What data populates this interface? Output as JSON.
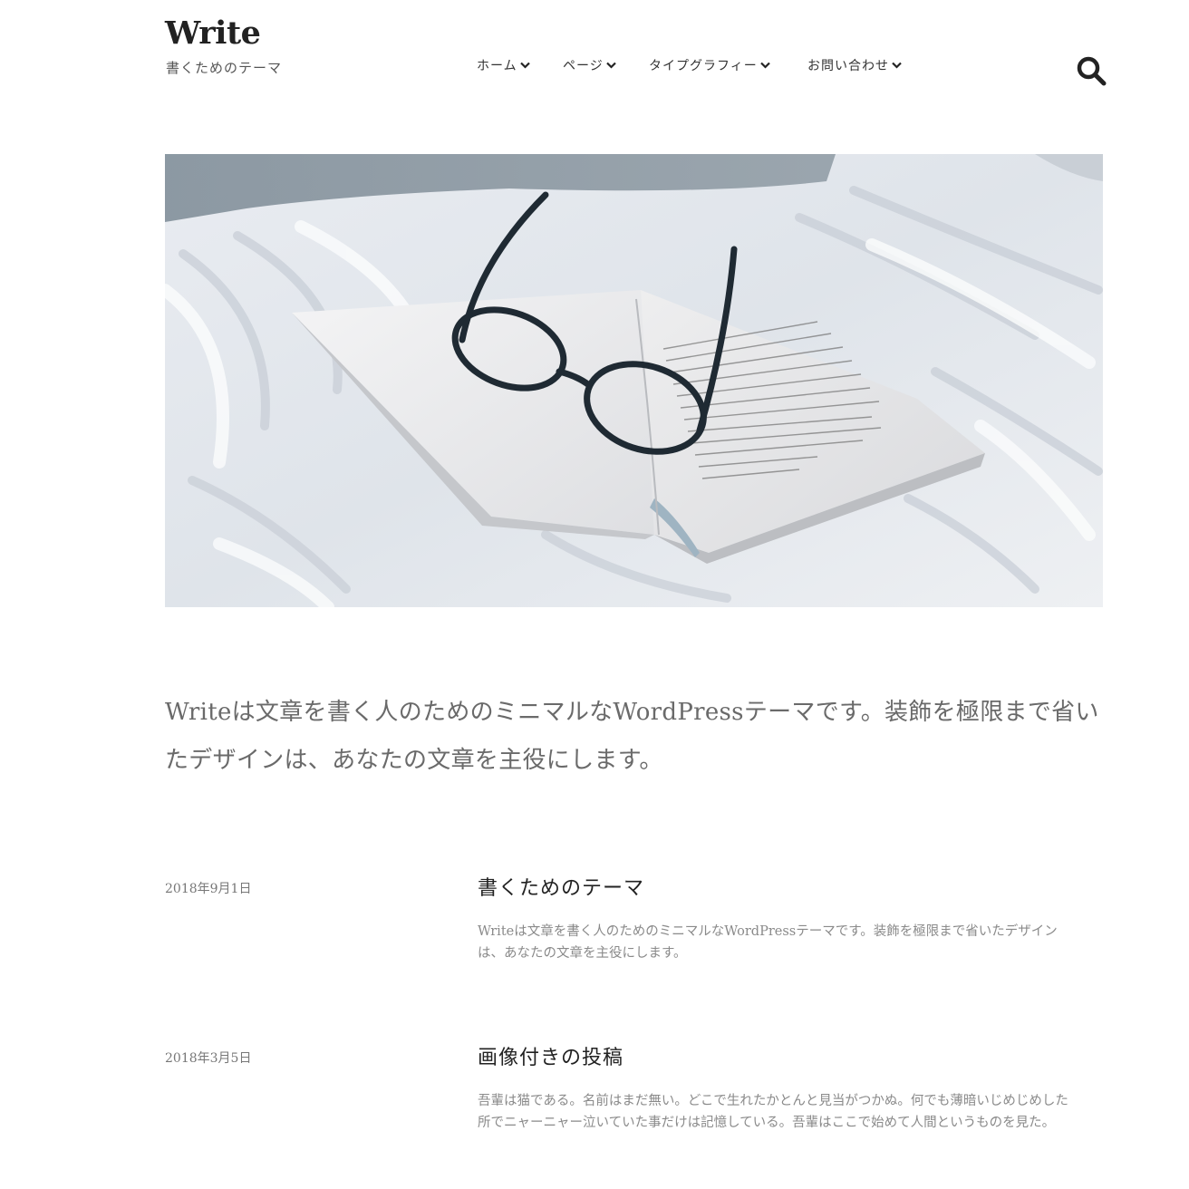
{
  "site": {
    "title": "Write",
    "description": "書くためのテーマ"
  },
  "nav": {
    "items": [
      {
        "label": "ホーム"
      },
      {
        "label": "ページ"
      },
      {
        "label": "タイプグラフィー"
      },
      {
        "label": "お問い合わせ"
      }
    ]
  },
  "hero": {
    "image": "open-book-with-glasses-photo"
  },
  "intro": {
    "text": "Writeは文章を書く人のためのミニマルなWordPressテーマです。装飾を極限まで省いたデザインは、あなたの文章を主役にします。"
  },
  "posts": [
    {
      "date": "2018年9月1日",
      "title": "書くためのテーマ",
      "excerpt": "Writeは文章を書く人のためのミニマルなWordPressテーマです。装飾を極限まで省いたデザインは、あなたの文章を主役にします。"
    },
    {
      "date": "2018年3月5日",
      "title": "画像付きの投稿",
      "excerpt": "吾輩は猫である。名前はまだ無い。どこで生れたかとんと見当がつかぬ。何でも薄暗いじめじめした所でニャーニャー泣いていた事だけは記憶している。吾輩はここで始めて人間というものを見た。"
    }
  ],
  "colors": {
    "text": "#222222",
    "muted": "#8a8a8a",
    "intro": "#6a6a6a"
  }
}
